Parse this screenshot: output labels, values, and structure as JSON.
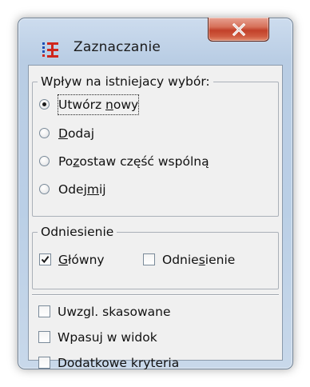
{
  "window": {
    "title": "Zaznaczanie",
    "close_glyph": "X"
  },
  "group_selection": {
    "label": "Wpływ na istniejacy wybór:",
    "options": [
      {
        "pre": "Utwórz ",
        "accel": "n",
        "post": "owy",
        "selected": true
      },
      {
        "pre": "",
        "accel": "D",
        "post": "odaj",
        "selected": false
      },
      {
        "pre": "Po",
        "accel": "z",
        "post": "ostaw część wspólną",
        "selected": false
      },
      {
        "pre": "Odej",
        "accel": "m",
        "post": "ij",
        "selected": false
      }
    ]
  },
  "group_reference": {
    "label": "Odniesienie",
    "main": {
      "pre": "",
      "accel": "G",
      "post": "łówny",
      "checked": true
    },
    "reference": {
      "pre": "Odnie",
      "accel": "s",
      "post": "ienie",
      "checked": false
    }
  },
  "extra_options": [
    {
      "label": "Uwzgl. skasowane",
      "checked": false
    },
    {
      "label": "Wpasuj w widok",
      "checked": false
    },
    {
      "label": "Dodatkowe kryteria",
      "checked": false
    }
  ],
  "icons": {
    "app": "selection-app-icon",
    "close": "close-icon",
    "check": "checkmark-icon"
  },
  "colors": {
    "frame": "#bacfe6",
    "close_button": "#c2412a",
    "dialog_background": "#f0f0f0"
  }
}
